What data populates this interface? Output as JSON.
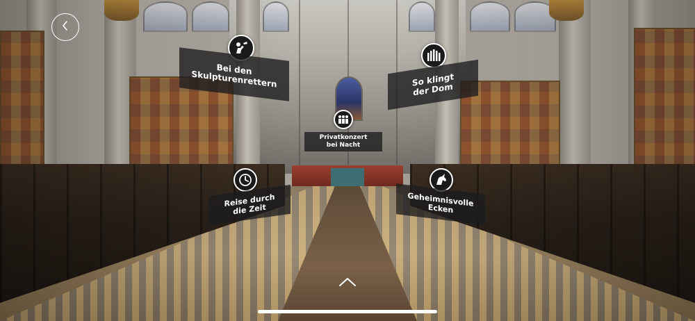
{
  "navigation": {
    "back_icon": "chevron-left-icon",
    "up_icon": "chevron-up-icon"
  },
  "hotspots": [
    {
      "id": "skulpturen",
      "label": "Bei den\nSkulpturenrettern",
      "icon": "sculptor-icon"
    },
    {
      "id": "dom-klang",
      "label": "So klingt\nder Dom",
      "icon": "organ-icon"
    },
    {
      "id": "privatkonzert",
      "label": "Privatkonzert\nbei Nacht",
      "icon": "choir-icon"
    },
    {
      "id": "zeitreise",
      "label": "Reise durch\ndie Zeit",
      "icon": "clock-icon"
    },
    {
      "id": "ecken",
      "label": "Geheimnisvolle\nEcken",
      "icon": "unicorn-icon"
    }
  ],
  "colors": {
    "icon_bg": "#1a1a1a",
    "label_bg": "#1c1c1e",
    "text": "#ffffff"
  }
}
